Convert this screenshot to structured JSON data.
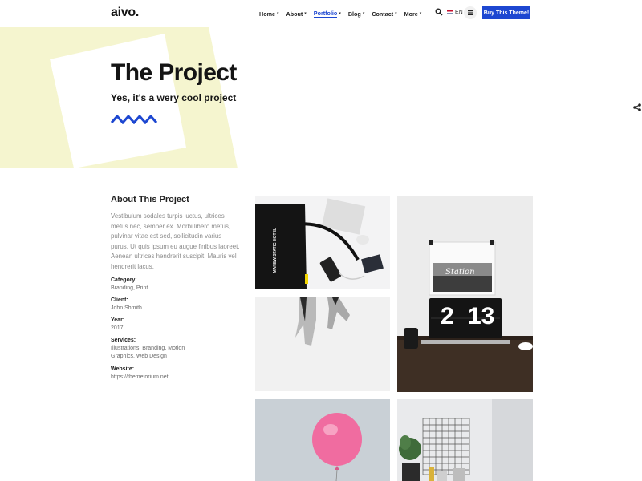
{
  "header": {
    "logo": "aivo.",
    "nav": [
      {
        "label": "Home",
        "active": false
      },
      {
        "label": "About",
        "active": false
      },
      {
        "label": "Portfolio",
        "active": true
      },
      {
        "label": "Blog",
        "active": false
      },
      {
        "label": "Contact",
        "active": false
      },
      {
        "label": "More",
        "active": false
      }
    ],
    "lang": "EN",
    "buy_label": "Buy This Theme!",
    "accent": "#1d47d1"
  },
  "hero": {
    "title": "The Project",
    "subtitle": "Yes, it's a wery cool project",
    "bg_color": "#f5f5cf"
  },
  "about": {
    "title": "About This Project",
    "text": "Vestibulum sodales turpis luctus, ultrices metus nec, semper ex. Morbi libero metus, pulvinar vitae est sed, sollicitudin varius purus. Ut quis ipsum eu augue finibus laoreet. Aenean ultrices hendrerit suscipit. Mauris vel hendrerit lacus.",
    "meta": [
      {
        "key": "Category:",
        "value": "Branding, Print"
      },
      {
        "key": "Client:",
        "value": "John Shmith"
      },
      {
        "key": "Year:",
        "value": "2017"
      },
      {
        "key": "Services:",
        "value": "Illustrations, Branding, Motion Graphics, Web Design"
      },
      {
        "key": "Website:",
        "value": "https://themetorium.net"
      }
    ]
  },
  "gallery": {
    "bag_text": "MANEW STATIC HOTEL",
    "clock_hour": "2",
    "clock_min": "13",
    "photo_caption": "Station"
  }
}
